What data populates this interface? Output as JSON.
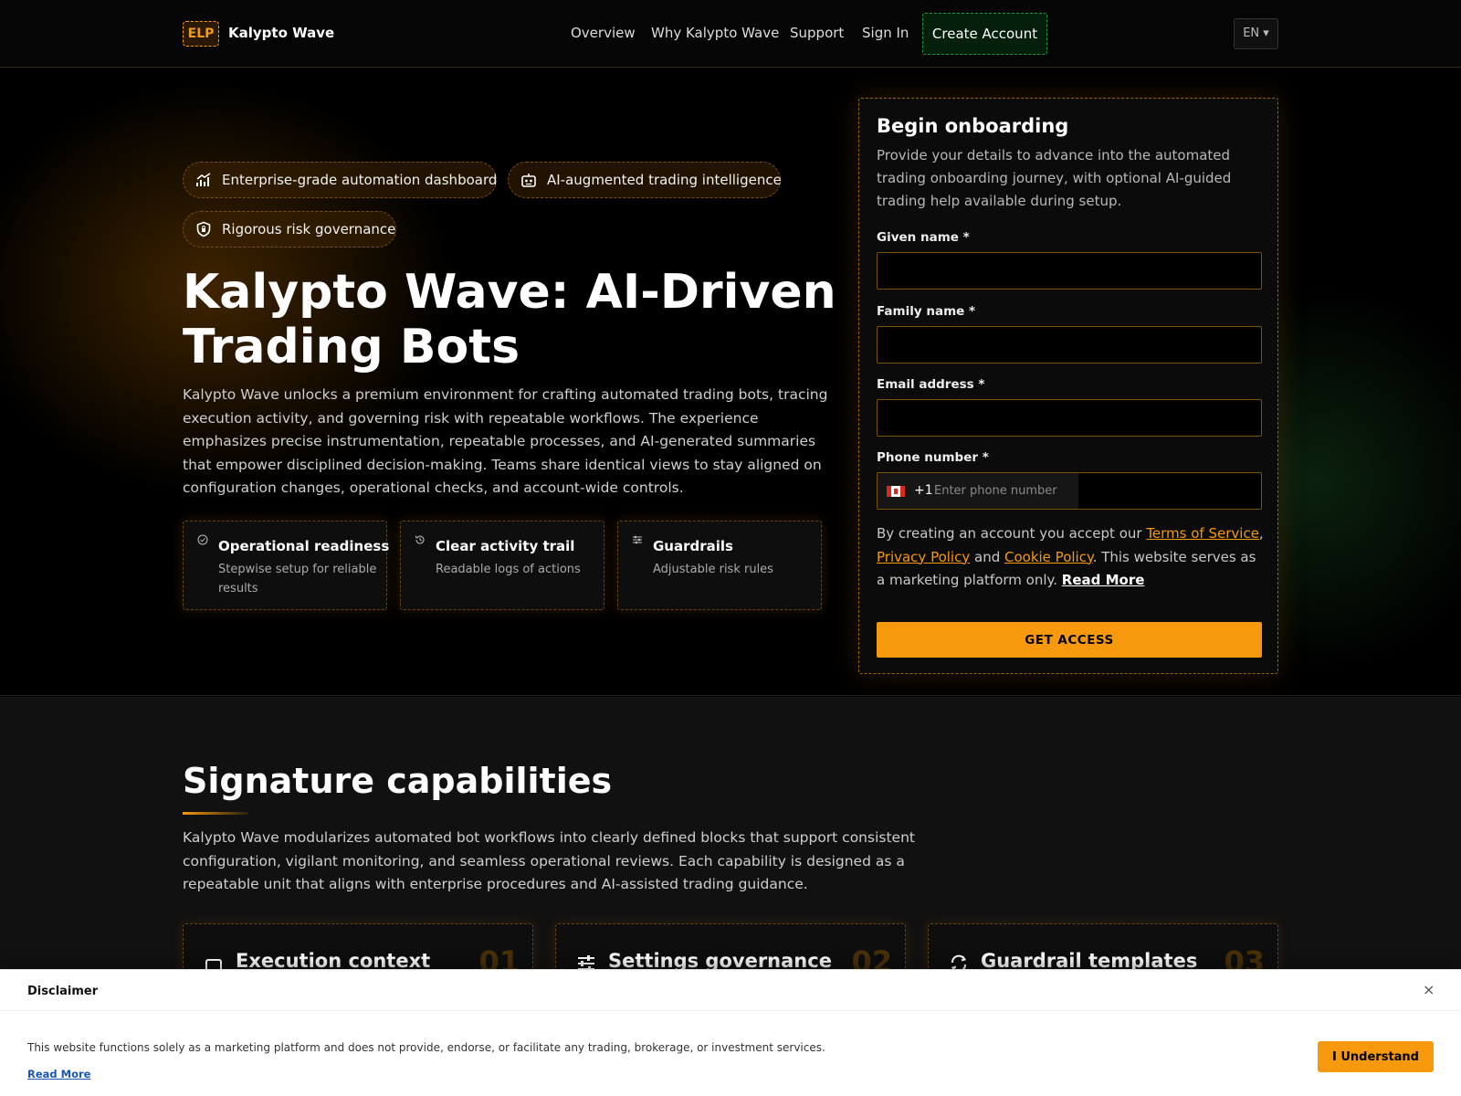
{
  "header": {
    "logo_badge": "ELP",
    "brand": "Kalypto Wave",
    "nav": [
      "Overview",
      "Why Kalypto Wave",
      "Support",
      "Sign In"
    ],
    "create_account": "Create Account",
    "language": "EN ▾"
  },
  "hero": {
    "pills": [
      {
        "label": "Enterprise-grade automation dashboard",
        "icon": "chart-icon"
      },
      {
        "label": "AI-augmented trading intelligence",
        "icon": "robot-icon"
      },
      {
        "label": "Rigorous risk governance",
        "icon": "shield-icon"
      }
    ],
    "title": "Kalypto Wave: AI-Driven Trading Bots",
    "description": "Kalypto Wave unlocks a premium environment for crafting automated trading bots, tracing execution activity, and governing risk with repeatable workflows. The experience emphasizes precise instrumentation, repeatable processes, and AI-generated summaries that empower disciplined decision-making. Teams share identical views to stay aligned on configuration changes, operational checks, and account-wide controls.",
    "features": [
      {
        "title": "Operational readiness",
        "subtitle": "Stepwise setup for reliable results",
        "icon": "check-circle-icon"
      },
      {
        "title": "Clear activity trail",
        "subtitle": "Readable logs of actions",
        "icon": "history-icon"
      },
      {
        "title": "Guardrails",
        "subtitle": "Adjustable risk rules",
        "icon": "sliders-icon"
      }
    ]
  },
  "form": {
    "title": "Begin onboarding",
    "subtitle": "Provide your details to advance into the automated trading onboarding journey, with optional AI-guided trading help available during setup.",
    "given_name_label": "Given name *",
    "family_name_label": "Family name *",
    "email_label": "Email address *",
    "phone_label": "Phone number *",
    "phone_dial_code": "+1",
    "phone_placeholder": "Enter phone number",
    "terms_prefix": "By creating an account you accept our ",
    "terms_link": "Terms of Service",
    "comma": ", ",
    "privacy_link": "Privacy Policy",
    "and": " and ",
    "cookie_link": "Cookie Policy",
    "terms_suffix": ". This website serves as a marketing platform only. ",
    "read_more": "Read More",
    "submit": "GET ACCESS"
  },
  "capabilities": {
    "title": "Signature capabilities",
    "description": "Kalypto Wave modularizes automated bot workflows into clearly defined blocks that support consistent configuration, vigilant monitoring, and seamless operational reviews. Each capability is designed as a repeatable unit that aligns with enterprise procedures and AI-assisted trading guidance.",
    "cards": [
      {
        "title": "Execution context",
        "number": "01",
        "icon": "terminal-icon"
      },
      {
        "title": "Settings governance",
        "number": "02",
        "icon": "sliders-icon"
      },
      {
        "title": "Guardrail templates",
        "number": "03",
        "icon": "template-icon"
      }
    ]
  },
  "disclaimer": {
    "title": "Disclaimer",
    "close": "×",
    "text": "This website functions solely as a marketing platform and does not provide, endorse, or facilitate any trading, brokerage, or investment services.",
    "read_more": "Read More",
    "button": "I Understand"
  },
  "colors": {
    "accent": "#f7990c",
    "green": "#1f9a3d",
    "background": "#000000"
  }
}
